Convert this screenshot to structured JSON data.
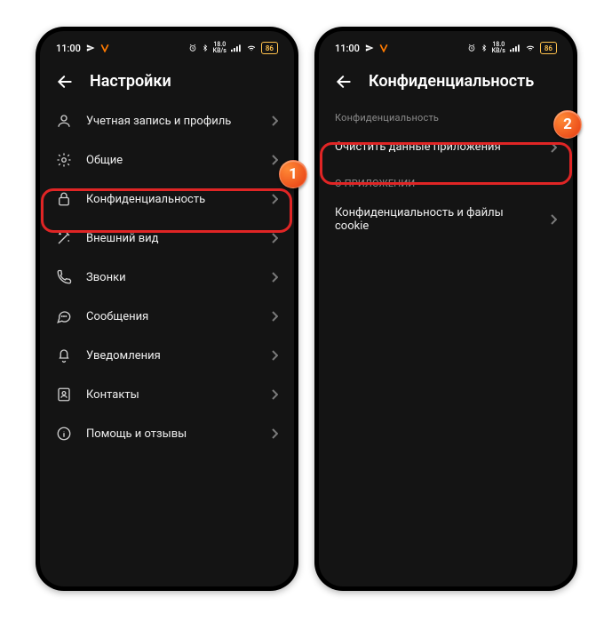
{
  "status": {
    "time": "11:00",
    "battery": "86",
    "net": "18.0"
  },
  "screen1": {
    "title": "Настройки",
    "items": [
      {
        "label": "Учетная запись и профиль"
      },
      {
        "label": "Общие"
      },
      {
        "label": "Конфиденциальность"
      },
      {
        "label": "Внешний вид"
      },
      {
        "label": "Звонки"
      },
      {
        "label": "Сообщения"
      },
      {
        "label": "Уведомления"
      },
      {
        "label": "Контакты"
      },
      {
        "label": "Помощь и отзывы"
      }
    ]
  },
  "screen2": {
    "title": "Конфиденциальность",
    "section1": "Конфиденциальность",
    "clear": "Очистить данные приложения",
    "section2": "О ПРИЛОЖЕНИИ",
    "cookie": "Конфиденциальность и файлы cookie"
  },
  "annot": {
    "b1": "1",
    "b2": "2"
  }
}
